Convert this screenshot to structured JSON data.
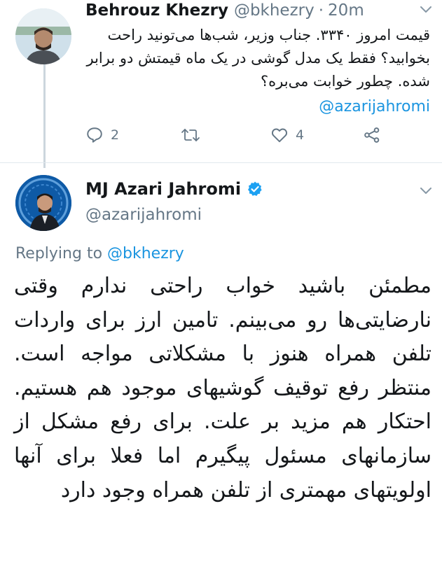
{
  "tweet1": {
    "author_name": "Behrouz Khezry",
    "handle": "@bkhezry",
    "separator": "·",
    "time": "20m",
    "text": "قیمت امروز ۳۳۴۰. جناب وزیر، شب‌ها می‌تونید راحت بخوابید؟ فقط یک مدل گوشی در یک ماه قیمتش دو برابر شده. چطور خوابت می‌بره؟",
    "mention": "@azarijahromi",
    "actions": {
      "reply_count": "2",
      "retweet_count": "",
      "like_count": "4"
    }
  },
  "tweet2": {
    "author_name": "MJ Azari Jahromi",
    "handle": "@azarijahromi",
    "replying_prefix": "Replying to",
    "replying_handle": "@bkhezry",
    "text": "مطمئن باشید خواب راحتی ندارم وقتی نارضایتی‌ها رو می‌بینم. تامین ارز برای واردات تلفن همراه هنوز با مشکلاتی مواجه است. منتظر رفع توقیف گوشیهای موجود هم هستیم. احتکار هم مزید بر علت. برای رفع مشکل از سازمانهای مسئول پیگیرم اما فعلا برای آنها اولویتهای مهمتری از تلفن همراه وجود دارد"
  },
  "icons": [
    "chevron-down-icon",
    "reply-icon",
    "retweet-icon",
    "like-icon",
    "share-icon",
    "verified-badge-icon"
  ],
  "colors": {
    "link": "#1b95e0",
    "muted": "#657786",
    "verified": "#1da1f2",
    "text": "#14171a"
  }
}
